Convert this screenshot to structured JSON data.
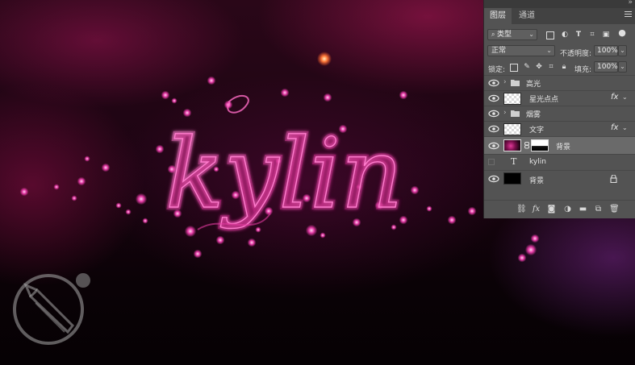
{
  "canvas": {
    "artwork_text": "kylin"
  },
  "panel": {
    "tabs": [
      {
        "label": "图层",
        "active": true
      },
      {
        "label": "通道",
        "active": false
      }
    ],
    "filter": {
      "kind_label": "类型"
    },
    "blend_mode": "正常",
    "opacity_label": "不透明度:",
    "opacity_value": "100%",
    "lock_label": "锁定:",
    "fill_label": "填充:",
    "fill_value": "100%",
    "layers": [
      {
        "name": "高光",
        "type": "group",
        "visible": true,
        "selected": false
      },
      {
        "name": "星光点点",
        "type": "pixel",
        "visible": true,
        "fx": "fx",
        "selected": false
      },
      {
        "name": "烟雾",
        "type": "group",
        "visible": true,
        "selected": false
      },
      {
        "name": "文字",
        "type": "pixel",
        "visible": true,
        "fx": "fx",
        "selected": false
      },
      {
        "name": "背景",
        "type": "masked",
        "visible": true,
        "selected": true
      },
      {
        "name": "kylin",
        "type": "text",
        "visible": false,
        "selected": false
      },
      {
        "name": "背景",
        "type": "background",
        "visible": true,
        "locked": true,
        "selected": false
      }
    ],
    "footer_icons": [
      "link-icon",
      "fx-icon",
      "mask-icon",
      "adjustment-icon",
      "folder-icon",
      "new-layer-icon",
      "trash-icon"
    ]
  },
  "colors": {
    "panel_bg": "#535353",
    "selected_row": "#6a6a6a",
    "accent_pink": "#e03a9c"
  }
}
